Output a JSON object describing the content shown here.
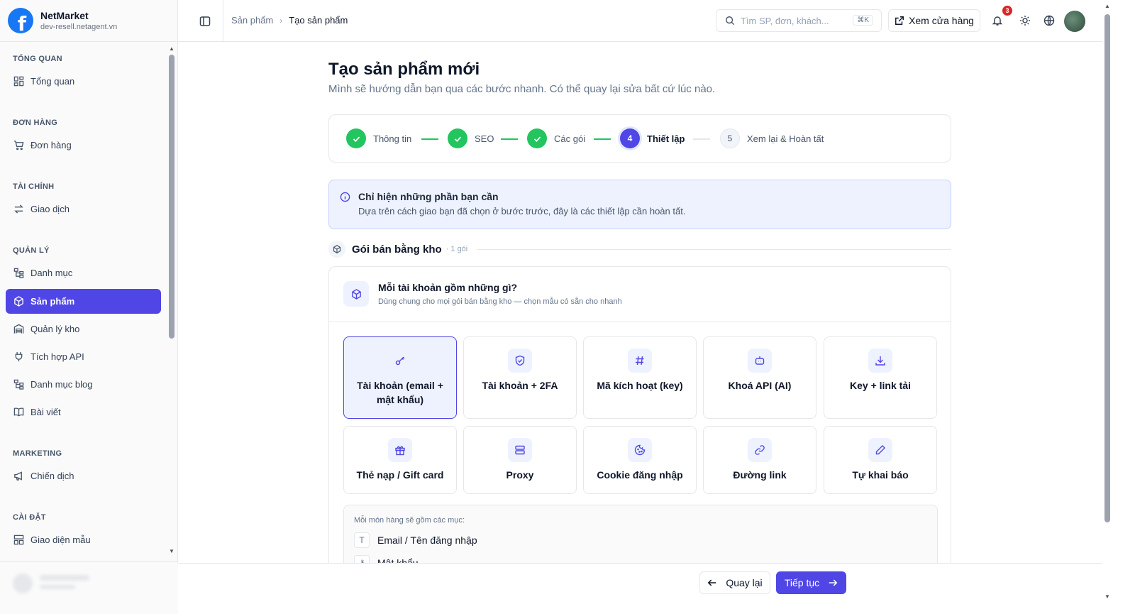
{
  "brand": {
    "name": "NetMarket",
    "domain": "dev-resell.netagent.vn"
  },
  "sidebar": {
    "sections": [
      {
        "label": "TỔNG QUAN",
        "items": [
          {
            "label": "Tổng quan",
            "icon": "dashboard-icon"
          }
        ]
      },
      {
        "label": "ĐƠN HÀNG",
        "items": [
          {
            "label": "Đơn hàng",
            "icon": "cart-icon"
          }
        ]
      },
      {
        "label": "TÀI CHÍNH",
        "items": [
          {
            "label": "Giao dịch",
            "icon": "transfer-icon"
          }
        ]
      },
      {
        "label": "QUẢN LÝ",
        "items": [
          {
            "label": "Danh mục",
            "icon": "tree-icon"
          },
          {
            "label": "Sản phẩm",
            "icon": "cube-icon",
            "active": true
          },
          {
            "label": "Quản lý kho",
            "icon": "warehouse-icon"
          },
          {
            "label": "Tích hợp API",
            "icon": "plug-icon"
          },
          {
            "label": "Danh mục blog",
            "icon": "tree-icon"
          },
          {
            "label": "Bài viết",
            "icon": "book-icon"
          }
        ]
      },
      {
        "label": "MARKETING",
        "items": [
          {
            "label": "Chiến dịch",
            "icon": "megaphone-icon"
          }
        ]
      },
      {
        "label": "CÀI ĐẶT",
        "items": [
          {
            "label": "Giao diện mẫu",
            "icon": "layout-icon"
          }
        ]
      }
    ]
  },
  "header": {
    "breadcrumb": [
      "Sản phẩm",
      "Tạo sản phẩm"
    ],
    "search_placeholder": "Tìm SP, đơn, khách...",
    "search_shortcut": "⌘K",
    "store_button": "Xem cửa hàng",
    "notification_count": "3"
  },
  "page": {
    "title": "Tạo sản phẩm mới",
    "subtitle": "Mình sẽ hướng dẫn bạn qua các bước nhanh. Có thể quay lại sửa bất cứ lúc nào."
  },
  "steps": [
    {
      "label": "Thông tin",
      "status": "done",
      "number": "1"
    },
    {
      "label": "SEO",
      "status": "done",
      "number": "2"
    },
    {
      "label": "Các gói",
      "status": "done",
      "number": "3"
    },
    {
      "label": "Thiết lập",
      "status": "active",
      "number": "4"
    },
    {
      "label": "Xem lại & Hoàn tất",
      "status": "todo",
      "number": "5"
    }
  ],
  "info": {
    "title": "Chỉ hiện những phần bạn cần",
    "description": "Dựa trên cách giao bạn đã chọn ở bước trước, đây là các thiết lập cần hoàn tất."
  },
  "section": {
    "title": "Gói bán bằng kho",
    "count": "· 1 gói"
  },
  "card": {
    "title": "Mỗi tài khoản gồm những gì?",
    "subtitle": "Dùng chung cho mọi gói bán bằng kho — chọn mẫu có sẵn cho nhanh"
  },
  "options": [
    {
      "label": "Tài khoản (email + mật khẩu)",
      "icon": "key-icon",
      "selected": true
    },
    {
      "label": "Tài khoản + 2FA",
      "icon": "shield-icon"
    },
    {
      "label": "Mã kích hoạt (key)",
      "icon": "hash-icon"
    },
    {
      "label": "Khoá API (AI)",
      "icon": "bot-icon"
    },
    {
      "label": "Key + link tải",
      "icon": "download-icon"
    },
    {
      "label": "Thẻ nạp / Gift card",
      "icon": "gift-icon"
    },
    {
      "label": "Proxy",
      "icon": "server-icon"
    },
    {
      "label": "Cookie đăng nhập",
      "icon": "cookie-icon"
    },
    {
      "label": "Đường link",
      "icon": "link-icon"
    },
    {
      "label": "Tự khai báo",
      "icon": "pencil-icon"
    }
  ],
  "fields": {
    "label": "Mỗi món hàng sẽ gồm các mục:",
    "items": [
      {
        "label": "Email / Tên đăng nhập",
        "icon": "text-icon"
      },
      {
        "label": "Mật khẩu",
        "icon": "lock-icon"
      }
    ]
  },
  "footer": {
    "back_label": "Quay lại",
    "next_label": "Tiếp tục"
  },
  "colors": {
    "primary": "#4f46e5",
    "success": "#22c55e",
    "badge": "#dc2626"
  }
}
